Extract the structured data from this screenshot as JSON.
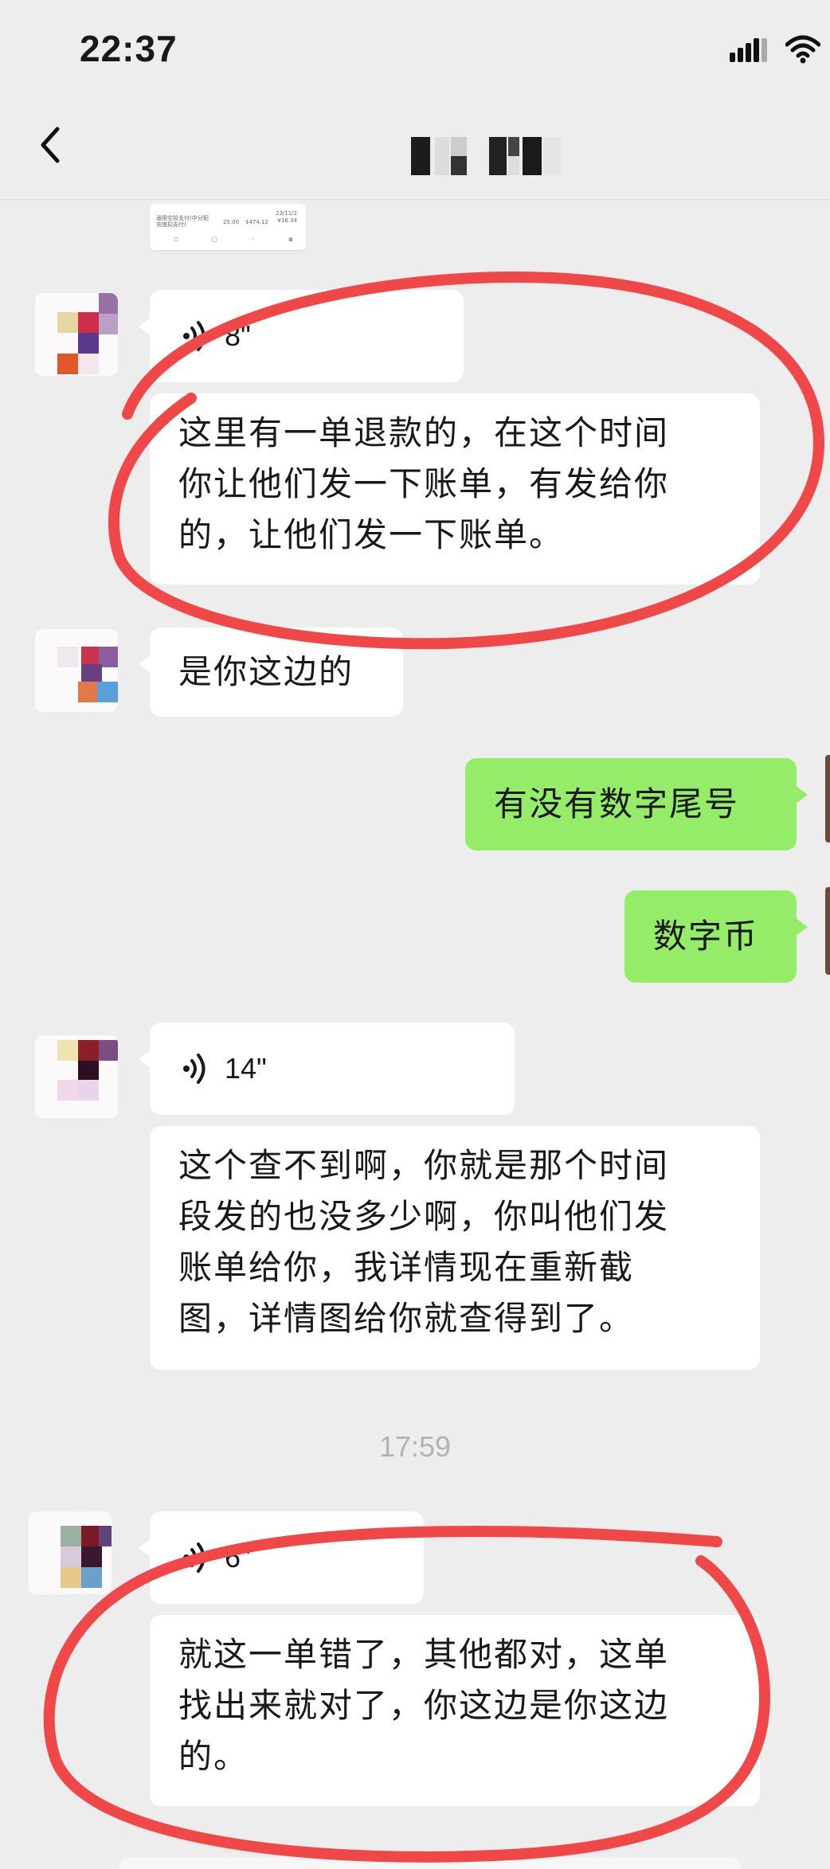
{
  "status_bar": {
    "time": "22:37"
  },
  "header": {
    "title": "",
    "back_icon": "chevron-left-icon"
  },
  "shared_card": {
    "line1": "通用空投支付(中分配",
    "line2": "充值扣支付)",
    "amount1": "25.00",
    "amount2": "$474.12",
    "date": "23/11/2",
    "value": "¥16.34"
  },
  "messages": [
    {
      "sender": "other",
      "type": "voice",
      "duration": "8\""
    },
    {
      "sender": "other",
      "type": "text",
      "lines": [
        "这里有一单退款的，在这个时间",
        "你让他们发一下账单，有发给你",
        "的，让他们发一下账单。"
      ]
    },
    {
      "sender": "other",
      "type": "text",
      "lines": [
        "是你这边的"
      ]
    },
    {
      "sender": "me",
      "type": "text",
      "lines": [
        "有没有数字尾号"
      ]
    },
    {
      "sender": "me",
      "type": "text",
      "lines": [
        "数字币"
      ]
    },
    {
      "sender": "other",
      "type": "voice",
      "duration": "14\""
    },
    {
      "sender": "other",
      "type": "text",
      "lines": [
        "这个查不到啊，你就是那个时间",
        "段发的也没多少啊，你叫他们发",
        "账单给你，我详情现在重新截",
        "图，详情图给你就查得到了。"
      ]
    },
    {
      "sender": "other",
      "type": "voice",
      "duration": "6\""
    },
    {
      "sender": "other",
      "type": "text",
      "lines": [
        "就这一单错了，其他都对，这单",
        "找出来就对了，你这边是你这边",
        "的。"
      ]
    }
  ],
  "timestamp": "17:59",
  "colors": {
    "background": "#ededed",
    "my_bubble": "#95ec69",
    "other_bubble": "#ffffff",
    "annotation": "#f04848"
  }
}
